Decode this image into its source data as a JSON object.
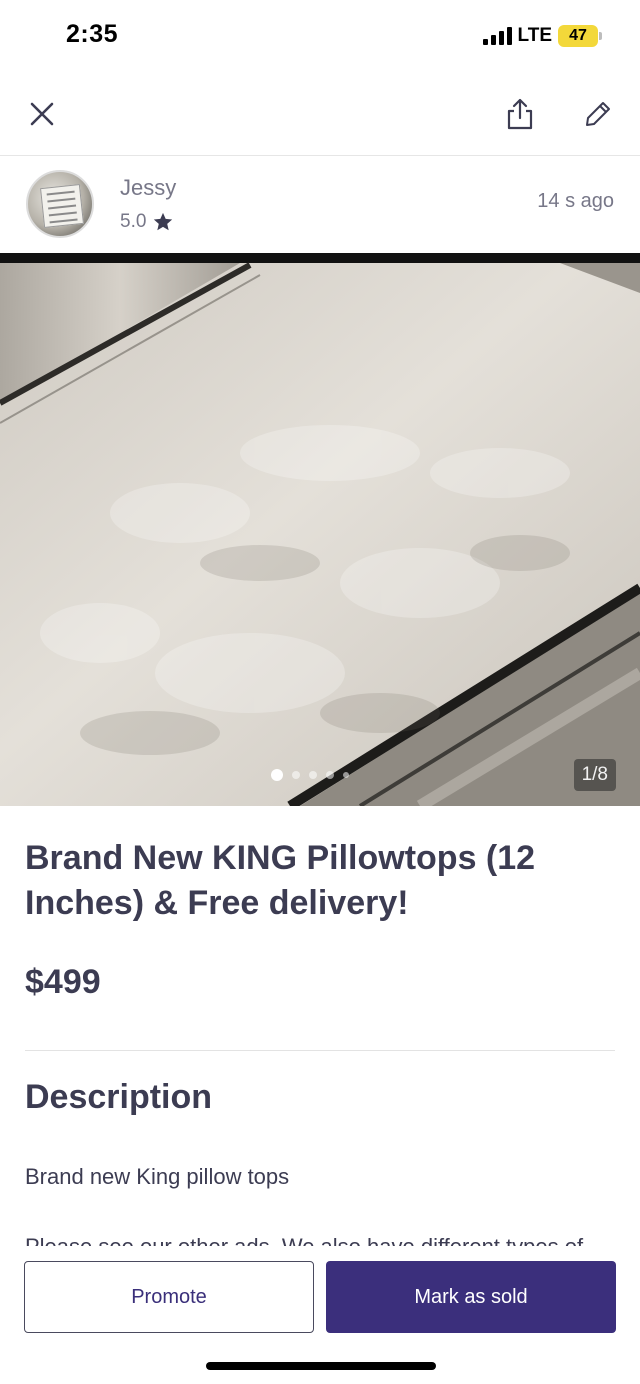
{
  "status_bar": {
    "time": "2:35",
    "network": "LTE",
    "battery": "47",
    "battery_color": "#f3d83a",
    "icons": [
      "signal-bars-icon",
      "battery-icon"
    ]
  },
  "toolbar": {
    "icons": [
      "close-icon",
      "share-icon",
      "edit-pencil-icon"
    ]
  },
  "seller": {
    "name": "Jessy",
    "rating": "5.0",
    "rating_icon": "star-icon",
    "posted": "14 s  ago"
  },
  "photo": {
    "counter": "1/8",
    "total_images": 8,
    "current_index": 1
  },
  "listing": {
    "title": "Brand New KING Pillowtops (12 Inches) & Free delivery!",
    "price": "$499"
  },
  "description": {
    "heading": "Description",
    "line1": "Brand new King pillow tops",
    "line2": "Please see our other ads. We also have different types of"
  },
  "actions": {
    "promote_label": "Promote",
    "mark_sold_label": "Mark as sold"
  },
  "colors": {
    "accent": "#3b2f7c",
    "text": "#3c3c52",
    "muted": "#777788"
  }
}
